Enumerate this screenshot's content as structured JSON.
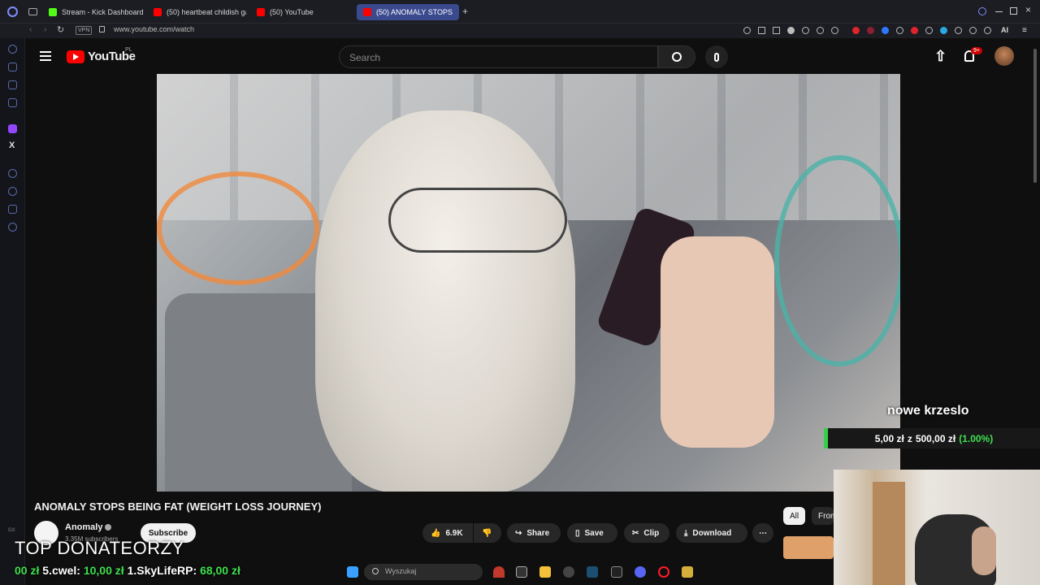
{
  "browser": {
    "tabs": [
      {
        "label": "Stream - Kick Dashboard",
        "color": "#53fc18"
      },
      {
        "label": "(50) heartbeat childish ga",
        "color": "#ff0000"
      },
      {
        "label": "(50) YouTube",
        "color": "#ff0000"
      },
      {
        "label": "(50) ANOMALY STOPS",
        "color": "#ff0000"
      }
    ],
    "vpn": "VPN",
    "url": "www.youtube.com/watch",
    "ai_label": "AI"
  },
  "youtube": {
    "logo": "YouTube",
    "country": "PL",
    "search_placeholder": "Search",
    "notif_count": "9+",
    "video_title": "ANOMALY STOPS BEING FAT (WEIGHT LOSS JOURNEY)",
    "channel_name": "Anomaly",
    "subscribers": "3.35M subscribers",
    "subscribe_label": "Subscribe",
    "likes": "6.9K",
    "share_label": "Share",
    "save_label": "Save",
    "clip_label": "Clip",
    "download_label": "Download",
    "chip_all": "All",
    "chip_from": "From"
  },
  "overlay": {
    "goal_name": "nowe krzeslo",
    "goal_current": "5,00 zł",
    "goal_sep": "z",
    "goal_target": "500,00 zł",
    "goal_percent": "(1.00%)",
    "top_donors_title": "TOP DONATEORZY",
    "ticker": [
      {
        "rank": "",
        "name": "",
        "amount": "00 zł"
      },
      {
        "rank": "5.",
        "name": "cwel:",
        "amount": "10,00 zł"
      },
      {
        "rank": "1.",
        "name": "SkyLifeRP:",
        "amount": "68,00 zł"
      }
    ]
  },
  "taskbar": {
    "search_placeholder": "Wyszukaj"
  },
  "sidebar_left_label": "GX"
}
